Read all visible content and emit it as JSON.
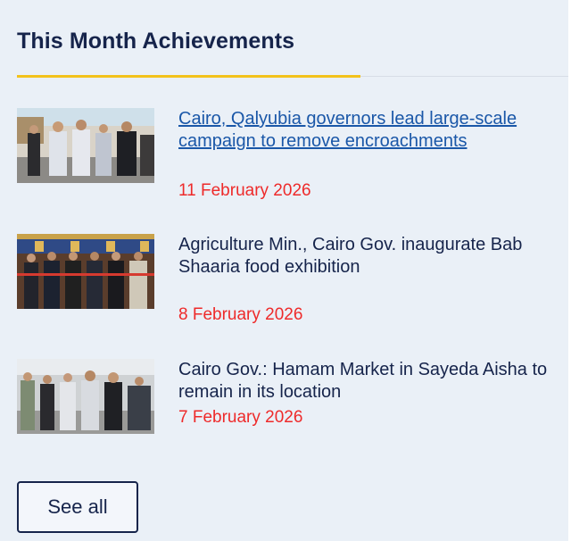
{
  "section": {
    "title": "This Month Achievements"
  },
  "items": [
    {
      "headline": "Cairo, Qalyubia governors lead large-scale campaign to remove encroachments",
      "date": "11 February 2026",
      "thumbnail": "officials-walking-street-photo"
    },
    {
      "headline": "Agriculture Min., Cairo Gov. inaugurate Bab Shaaria food exhibition",
      "date": "8 February 2026",
      "thumbnail": "ribbon-cutting-ceremony-photo"
    },
    {
      "headline": "Cairo Gov.: Hamam Market in Sayeda Aisha to remain in its location",
      "date": "7 February 2026",
      "thumbnail": "market-visit-photo"
    }
  ],
  "see_all_label": "See all",
  "colors": {
    "background": "#eaf0f7",
    "title": "#16244b",
    "accent_underline": "#f3c21b",
    "link_active": "#1a57a8",
    "date": "#ee2a2a"
  }
}
